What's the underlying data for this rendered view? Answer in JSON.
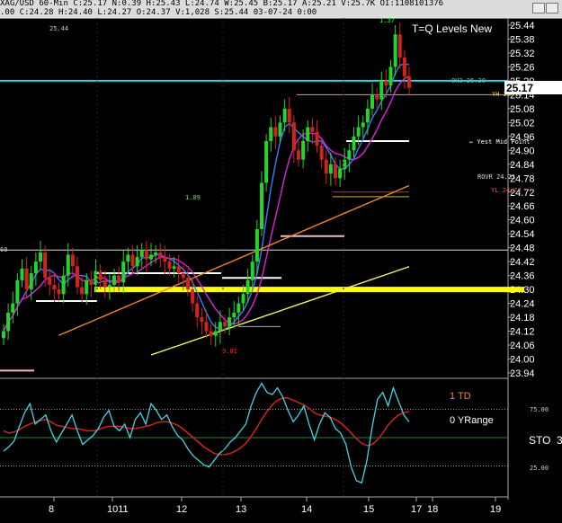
{
  "header": {
    "symbol_line": "XAG/USD  60-Min  C:25.17  N:0.39  H:25.43  L:24.74  W:25.45  B:25.17  A:25.21  V:25.7K  OI:1108101376",
    "ohlc_line": ".00  C:24.28  H:24.40  L:24.27  O:24.37  V:1,028  S:25.44  03-07-24  0:00"
  },
  "annotations": {
    "title": "T=Q Levels New",
    "top_price": "25.44",
    "high_marker": "1.37",
    "label_109": "1.09",
    "low_marker": "0.01",
    "oh3": "OH3 25.20",
    "yh": "YH 25.14",
    "yest_mid": "← Yest Mid Point",
    "rovr": "ROVR 24.71",
    "yl": "YL 24.72",
    "left_cut": "60",
    "current_price": "25.17"
  },
  "indicator": {
    "label_td": "1 TD",
    "label_yrange": "0 YRange",
    "label_sto": "STO",
    "label_sto_num": "3",
    "tick_75": "75.00",
    "tick_25": "25.00"
  },
  "chart_data": {
    "type": "candlestick",
    "timeframe": "60-Min",
    "y_ticks": [
      "25.44",
      "25.38",
      "25.32",
      "25.26",
      "25.20",
      "25.14",
      "25.08",
      "25.02",
      "24.96",
      "24.90",
      "24.84",
      "24.78",
      "24.72",
      "24.66",
      "24.60",
      "24.54",
      "24.48",
      "24.42",
      "24.36",
      "24.30",
      "24.24",
      "24.18",
      "24.12",
      "24.06",
      "24.00",
      "23.94"
    ],
    "ylim": [
      23.94,
      25.44
    ],
    "x_ticks": [
      "8",
      "1011",
      "12",
      "13",
      "14",
      "15",
      "17",
      "18",
      "19"
    ],
    "levels": [
      {
        "label": "OH3",
        "value": 25.2
      },
      {
        "label": "YH",
        "value": 25.14
      },
      {
        "label": "ROVR",
        "value": 24.71
      },
      {
        "label": "YL",
        "value": 24.72
      },
      {
        "label": "support",
        "value": 24.3
      }
    ],
    "close_series": [
      24.12,
      24.2,
      24.24,
      24.34,
      24.39,
      24.3,
      24.37,
      24.42,
      24.46,
      24.35,
      24.32,
      24.3,
      24.28,
      24.36,
      24.45,
      24.4,
      24.31,
      24.28,
      24.34,
      24.32,
      24.38,
      24.34,
      24.31,
      24.32,
      24.36,
      24.33,
      24.42,
      24.45,
      24.4,
      24.44,
      24.47,
      24.43,
      24.45,
      24.46,
      24.44,
      24.42,
      24.39,
      24.4,
      24.37,
      24.35,
      24.3,
      24.24,
      24.18,
      24.16,
      24.12,
      24.1,
      24.12,
      24.16,
      24.14,
      24.18,
      24.2,
      24.24,
      24.28,
      24.34,
      24.42,
      24.56,
      24.76,
      24.94,
      25.0,
      24.96,
      25.02,
      25.08,
      25.02,
      24.9,
      24.86,
      24.94,
      25.0,
      24.98,
      24.92,
      24.86,
      24.8,
      24.84,
      24.78,
      24.82,
      24.86,
      24.9,
      24.96,
      25.0,
      25.02,
      25.08,
      25.14,
      25.12,
      25.2,
      25.18,
      25.26,
      25.4,
      25.3,
      25.22,
      25.17
    ],
    "indicator_series": {
      "stochastic": [
        38,
        42,
        47,
        60,
        72,
        80,
        62,
        66,
        70,
        56,
        46,
        54,
        62,
        70,
        56,
        44,
        48,
        52,
        58,
        68,
        74,
        60,
        56,
        62,
        50,
        66,
        72,
        62,
        80,
        74,
        66,
        70,
        60,
        52,
        48,
        40,
        34,
        30,
        26,
        24,
        30,
        36,
        40,
        46,
        50,
        56,
        62,
        78,
        90,
        98,
        90,
        88,
        94,
        86,
        74,
        64,
        70,
        78,
        62,
        48,
        62,
        72,
        68,
        58,
        54,
        44,
        24,
        12,
        10,
        30,
        60,
        84,
        90,
        78,
        94,
        82,
        70,
        64
      ],
      "signal": [
        56,
        54,
        55,
        57,
        60,
        62,
        64,
        65,
        66,
        64,
        61,
        60,
        59,
        58,
        58,
        57,
        56,
        56,
        57,
        59,
        60,
        60,
        60,
        59,
        58,
        58,
        59,
        60,
        61,
        63,
        64,
        64,
        63,
        61,
        58,
        54,
        50,
        46,
        42,
        39,
        36,
        35,
        35,
        36,
        38,
        41,
        45,
        51,
        58,
        66,
        73,
        79,
        83,
        85,
        85,
        83,
        81,
        79,
        76,
        72,
        70,
        69,
        68,
        66,
        63,
        59,
        54,
        49,
        45,
        43,
        44,
        48,
        54,
        61,
        66,
        70,
        72,
        73
      ]
    },
    "indicator_ticks": [
      "75.00",
      "25.00"
    ]
  }
}
